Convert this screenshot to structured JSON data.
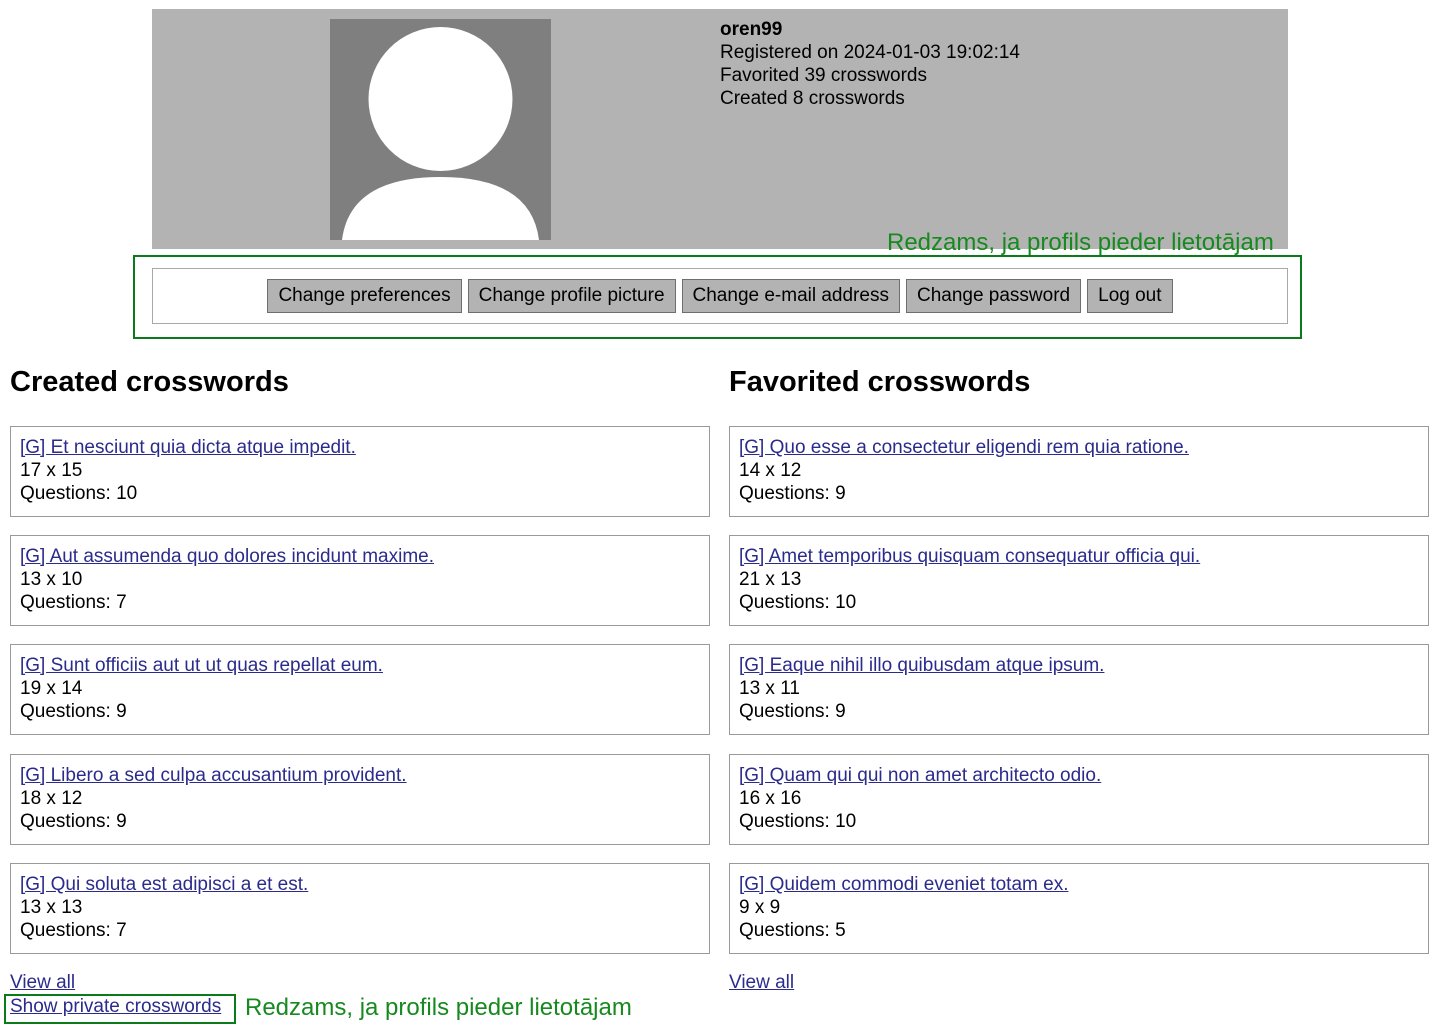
{
  "profile": {
    "username": "oren99",
    "registered": "Registered on 2024-01-03 19:02:14",
    "favorited": "Favorited 39 crosswords",
    "created": "Created 8 crosswords",
    "avatar_icon": "default-user-avatar-icon"
  },
  "annotations": {
    "owner_visible_top": "Redzams, ja profils pieder lietotājam",
    "owner_visible_bottom": "Redzams, ja profils pieder lietotājam",
    "color": "#178a1f"
  },
  "actions": [
    {
      "label": "Change preferences"
    },
    {
      "label": "Change profile picture"
    },
    {
      "label": "Change e-mail address"
    },
    {
      "label": "Change password"
    },
    {
      "label": "Log out"
    }
  ],
  "created_section": {
    "title": "Created crosswords",
    "view_all": "View all",
    "show_private": "Show private crosswords",
    "items": [
      {
        "title": "[G] Et nesciunt quia dicta atque impedit.",
        "size": "17 x 15",
        "questions": "Questions: 10"
      },
      {
        "title": "[G] Aut assumenda quo dolores incidunt maxime.",
        "size": "13 x 10",
        "questions": "Questions: 7"
      },
      {
        "title": "[G] Sunt officiis aut ut ut quas repellat eum.",
        "size": "19 x 14",
        "questions": "Questions: 9"
      },
      {
        "title": "[G] Libero a sed culpa accusantium provident.",
        "size": "18 x 12",
        "questions": "Questions: 9"
      },
      {
        "title": "[G] Qui soluta est adipisci a et est.",
        "size": "13 x 13",
        "questions": "Questions: 7"
      }
    ]
  },
  "favorited_section": {
    "title": "Favorited crosswords",
    "view_all": "View all",
    "items": [
      {
        "title": "[G] Quo esse a consectetur eligendi rem quia ratione.",
        "size": "14 x 12",
        "questions": "Questions: 9"
      },
      {
        "title": "[G] Amet temporibus quisquam consequatur officia qui.",
        "size": "21 x 13",
        "questions": "Questions: 10"
      },
      {
        "title": "[G] Eaque nihil illo quibusdam atque ipsum.",
        "size": "13 x 11",
        "questions": "Questions: 9"
      },
      {
        "title": "[G] Quam qui qui non amet architecto odio.",
        "size": "16 x 16",
        "questions": "Questions: 10"
      },
      {
        "title": "[G] Quidem commodi eveniet totam ex.",
        "size": "9 x 9",
        "questions": "Questions: 5"
      }
    ]
  }
}
